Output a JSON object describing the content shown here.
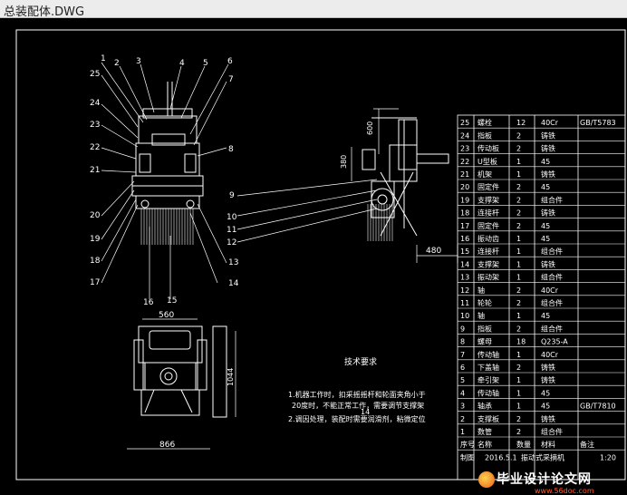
{
  "window": {
    "title": "总装配体.DWG"
  },
  "colors": {
    "background": "#000000",
    "line": "#ffffff",
    "leader": "#ffffff"
  },
  "left_view": {
    "balloons_top": [
      "1",
      "2",
      "3",
      "4",
      "5",
      "6"
    ],
    "balloons_left": [
      "25",
      "24",
      "23",
      "22",
      "21",
      "20",
      "19",
      "18",
      "17"
    ],
    "balloons_right": [
      "7",
      "8",
      "13",
      "14"
    ],
    "balloons_bottom": [
      "16",
      "15"
    ]
  },
  "side_view": {
    "balloons": [
      "9",
      "10",
      "11",
      "12"
    ],
    "dim_600": "600",
    "dim_380": "380",
    "dim_480": "480"
  },
  "bottom_view": {
    "dim_560": "560",
    "dim_1044": "1044",
    "dim_866": "866"
  },
  "tech": {
    "heading": "技术要求",
    "line1": "1.机器工作时，扣采摇摇杆和轮面夹角小于",
    "line2": "20度时，不能正常工作，需要调节支撑架",
    "line3": "2.调因处理，装配时需要润滑剂，粘微定位",
    "mark": "14"
  },
  "bom": {
    "rows": [
      [
        "25",
        "螺栓",
        "12",
        "40Cr",
        "GB/T5783"
      ],
      [
        "24",
        "指板",
        "2",
        "铸铁",
        ""
      ],
      [
        "23",
        "传动板",
        "2",
        "铸铁",
        ""
      ],
      [
        "22",
        "U型板",
        "1",
        "45",
        ""
      ],
      [
        "21",
        "机架",
        "1",
        "铸铁",
        ""
      ],
      [
        "20",
        "固定件",
        "2",
        "45",
        ""
      ],
      [
        "19",
        "支撑架",
        "2",
        "组合件",
        ""
      ],
      [
        "18",
        "连接杆",
        "2",
        "铸铁",
        ""
      ],
      [
        "17",
        "固定件",
        "2",
        "45",
        ""
      ],
      [
        "16",
        "振动齿",
        "1",
        "45",
        ""
      ],
      [
        "15",
        "连接杆",
        "1",
        "组合件",
        ""
      ],
      [
        "14",
        "支撑架",
        "1",
        "铸铁",
        ""
      ],
      [
        "13",
        "振动架",
        "1",
        "组合件",
        ""
      ],
      [
        "12",
        "轴",
        "2",
        "40Cr",
        ""
      ],
      [
        "11",
        "轮轮",
        "2",
        "组合件",
        ""
      ],
      [
        "10",
        "轴",
        "1",
        "45",
        ""
      ],
      [
        "9",
        "指板",
        "2",
        "组合件",
        ""
      ],
      [
        "8",
        "螺母",
        "18",
        "Q235-A",
        ""
      ],
      [
        "7",
        "传动轴",
        "1",
        "40Cr",
        ""
      ],
      [
        "6",
        "下盖轴",
        "2",
        "铸铁",
        ""
      ],
      [
        "5",
        "牵引架",
        "1",
        "铸铁",
        ""
      ],
      [
        "4",
        "传动轴",
        "1",
        "45",
        ""
      ],
      [
        "3",
        "轴承",
        "1",
        "45",
        "GB/T7810"
      ],
      [
        "2",
        "支撑板",
        "2",
        "铸铁",
        ""
      ],
      [
        "1",
        "数管",
        "2",
        "组合件",
        ""
      ]
    ],
    "header": [
      "序号",
      "名称",
      "数量",
      "材料",
      "备注"
    ],
    "footer_left": "制图",
    "footer_date": "2016.5.1",
    "footer_title": "振动式采摘机",
    "footer_scale": "1:20"
  },
  "watermark": {
    "text": "毕业设计论文网",
    "url": "www.56doc.com"
  }
}
